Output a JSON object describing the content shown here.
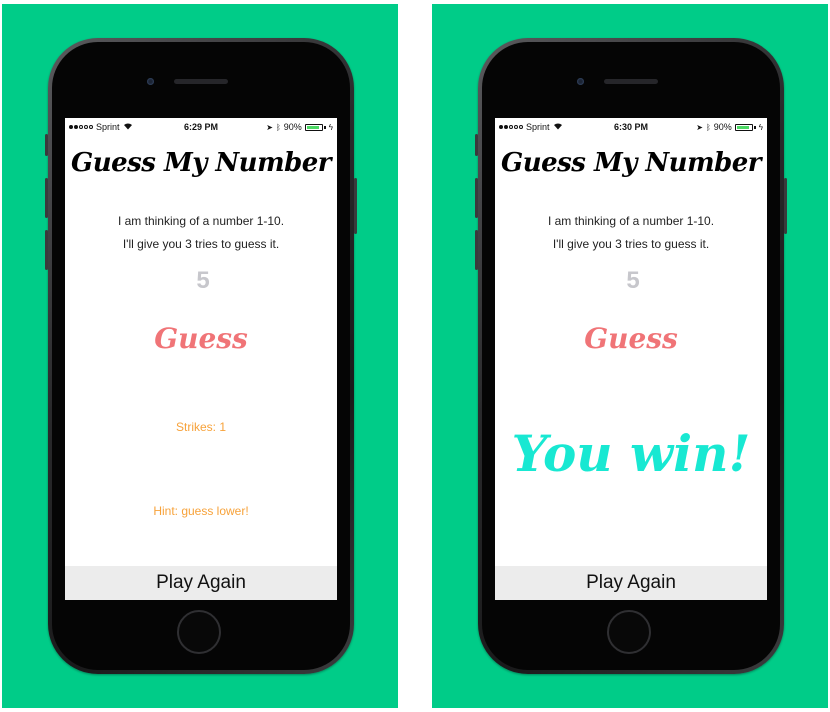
{
  "colors": {
    "background": "#00cc88",
    "guess_accent": "#f07477",
    "status_text": "#f7a23a",
    "win_text": "#18e8d2",
    "input_text": "#c7c7cc",
    "play_again_bg": "#ececec"
  },
  "screens": [
    {
      "status_bar": {
        "carrier": "Sprint",
        "time": "6:29 PM",
        "battery": "90%",
        "battery_level": 0.9
      },
      "title": "Guess My Number",
      "intro_line1": "I am thinking of a number 1-10.",
      "intro_line2": "I'll give you 3 tries to guess it.",
      "guess_value": "5",
      "guess_button": "Guess",
      "strikes": "Strikes: 1",
      "hint": "Hint: guess lower!",
      "play_again": "Play Again"
    },
    {
      "status_bar": {
        "carrier": "Sprint",
        "time": "6:30 PM",
        "battery": "90%",
        "battery_level": 0.9
      },
      "title": "Guess My Number",
      "intro_line1": "I am thinking of a number 1-10.",
      "intro_line2": "I'll give you 3 tries to guess it.",
      "guess_value": "5",
      "guess_button": "Guess",
      "win_message": "You win!",
      "play_again": "Play Again"
    }
  ]
}
